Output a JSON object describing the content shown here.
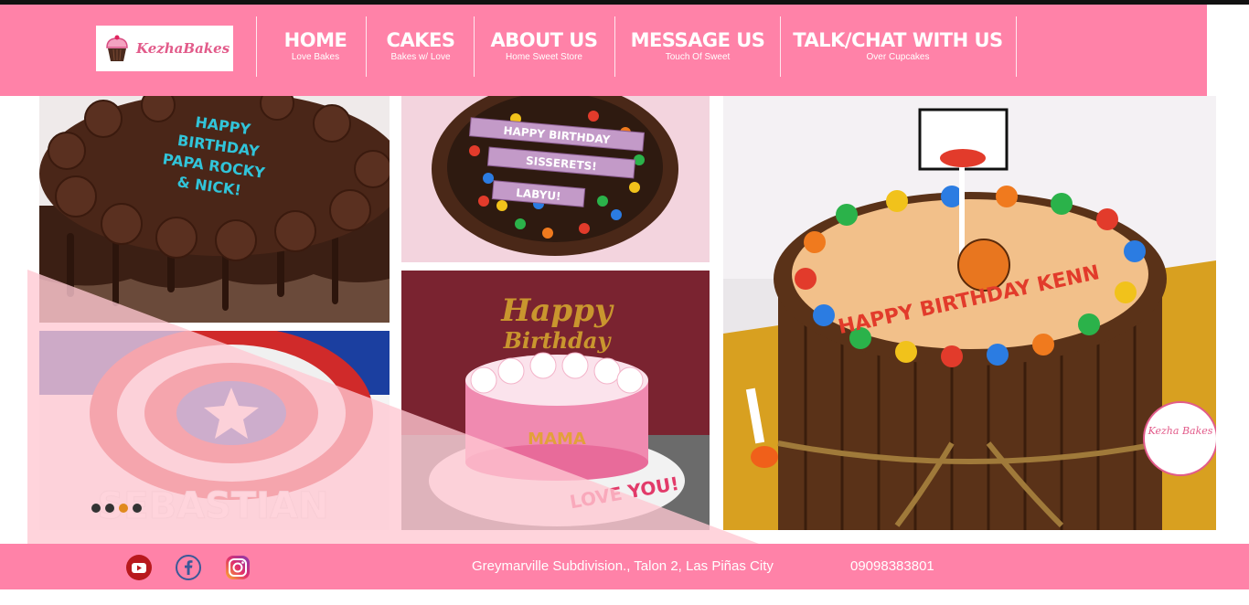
{
  "brand": {
    "logo_text": "KezhaBakes",
    "logo_icon": "cupcake-icon"
  },
  "nav": {
    "items": [
      {
        "title": "HOME",
        "sub": "Love Bakes"
      },
      {
        "title": "CAKES",
        "sub": "Bakes w/ Love"
      },
      {
        "title": "ABOUT US",
        "sub": "Home Sweet Store"
      },
      {
        "title": "MESSAGE US",
        "sub": "Touch Of Sweet"
      },
      {
        "title": "TALK/CHAT WITH US",
        "sub": "Over Cupcakes"
      }
    ]
  },
  "gallery": {
    "cake1": {
      "text": "HAPPY BIRTHDAY PAPA ROCKY & NICK!"
    },
    "cake2": {
      "banner1": "HAPPY BIRTHDAY",
      "banner2": "SISSERETS!",
      "banner3": "LABYU!"
    },
    "cake3": {
      "text": "SEBASTIAN"
    },
    "cake4": {
      "topper": "Happy Birthday",
      "name": "MAMA",
      "plate": "LOVE YOU!"
    },
    "cake5": {
      "arc": "HAPPY BIRTHDAY KENN",
      "tag": "Kezha Bakes"
    }
  },
  "slider": {
    "dot_count": 4,
    "active_index": 2
  },
  "footer": {
    "social": [
      {
        "name": "youtube-icon",
        "color": "#b8191d"
      },
      {
        "name": "facebook-icon",
        "color": "#3b5998"
      },
      {
        "name": "instagram-icon",
        "color": "#d62976"
      }
    ],
    "address": "Greymarville Subdivision., Talon 2, Las Piñas City",
    "phone": "09098383801"
  },
  "colors": {
    "brand_pink": "#ff82a8",
    "dot_active": "#e08a1e"
  }
}
